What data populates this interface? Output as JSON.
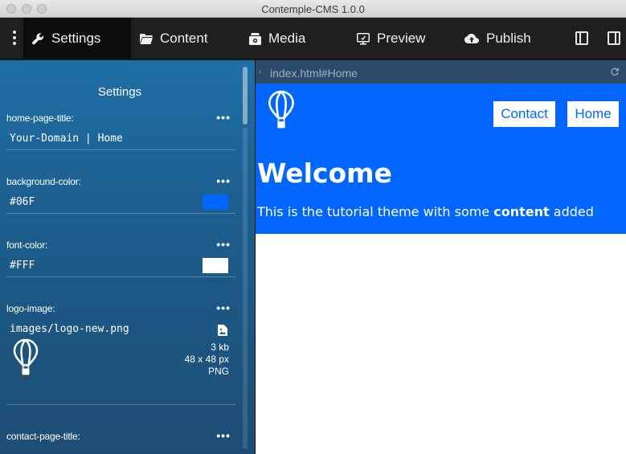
{
  "window": {
    "title": "Contemple-CMS 1.0.0"
  },
  "toolbar": {
    "tabs": [
      {
        "label": "Settings",
        "icon": "wrench-icon",
        "active": true
      },
      {
        "label": "Content",
        "icon": "folder-icon"
      },
      {
        "label": "Media",
        "icon": "media-icon"
      },
      {
        "label": "Preview",
        "icon": "monitor-icon"
      },
      {
        "label": "Publish",
        "icon": "cloud-upload-icon"
      }
    ]
  },
  "sidebar": {
    "heading": "Settings",
    "fields": [
      {
        "label": "home-page-title:",
        "value": "Your-Domain | Home"
      },
      {
        "label": "background-color:",
        "value": "#06F",
        "swatch": "#0066ff"
      },
      {
        "label": "font-color:",
        "value": "#FFF",
        "swatch": "#ffffff"
      },
      {
        "label": "logo-image:",
        "value": "images/logo-new.png",
        "size": "3 kb",
        "dimensions": "48 x 48 px",
        "format": "PNG"
      },
      {
        "label": "contact-page-title:"
      }
    ],
    "menu_glyph": "•••"
  },
  "preview": {
    "url": "index.html#Home",
    "nav": [
      "Contact",
      "Home"
    ],
    "title": "Welcome",
    "text_before": "This is the tutorial theme with some ",
    "text_bold": "content",
    "text_after": " added",
    "background": "#0066ff"
  }
}
